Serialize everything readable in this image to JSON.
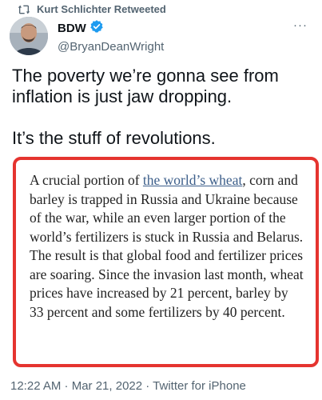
{
  "retweet": {
    "icon": "retweet-icon",
    "label": "Kurt Schlichter Retweeted"
  },
  "author": {
    "display_name": "BDW",
    "verified_icon": "verified-badge-icon",
    "handle": "@BryanDeanWright",
    "avatar": "avatar"
  },
  "more_icon": "more-icon",
  "more_glyph": "···",
  "tweet": {
    "text_line1": "The poverty we’re gonna see from inflation is just jaw dropping.",
    "text_line2": "It’s the stuff of revolutions."
  },
  "quote": {
    "before_link": "A crucial portion of ",
    "link_text": "the world’s wheat",
    "after_link": ", corn and barley is trapped in Russia and Ukraine because of the war, while an even larger portion of the world’s fertilizers is stuck in Russia and Belarus. The result is that global food and fertilizer prices are soaring. Since the invasion last month, wheat prices have increased by 21 percent, barley by 33 percent and some fertilizers by 40 percent."
  },
  "colors": {
    "highlight_border": "#e5342f",
    "link": "#3c5e8a",
    "verified": "#1d9bf0",
    "muted": "#536471"
  },
  "footer": {
    "timestamp": "12:22 AM · Mar 21, 2022 · Twitter for iPhone"
  }
}
